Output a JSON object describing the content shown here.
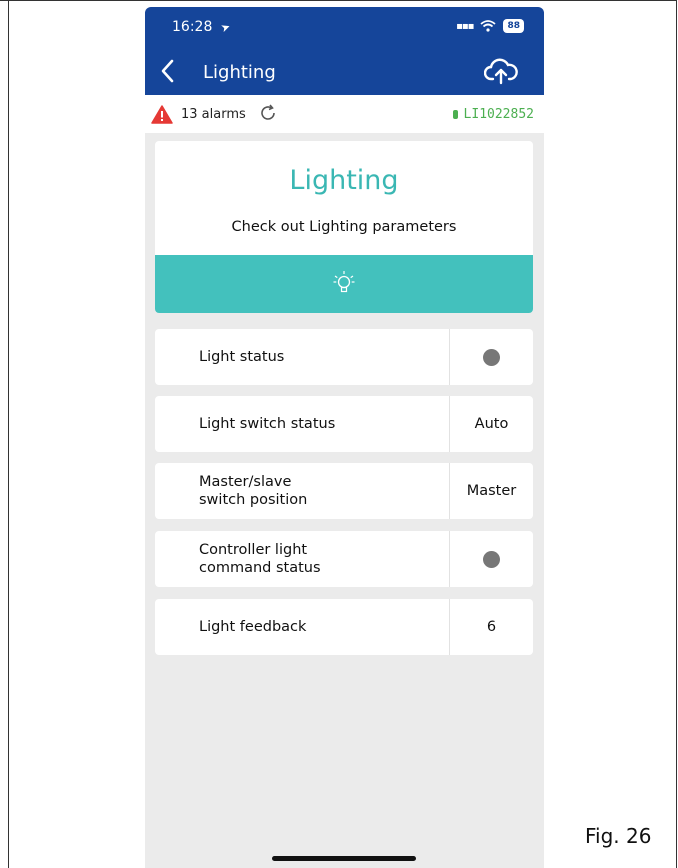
{
  "statusbar": {
    "time": "16:28",
    "battery": "88"
  },
  "navbar": {
    "title": "Lighting"
  },
  "alarmbar": {
    "alarms": "13 alarms",
    "device_id": "LI1022852"
  },
  "card": {
    "title": "Lighting",
    "subtitle": "Check out Lighting parameters"
  },
  "rows": [
    {
      "label": "Light status",
      "value": ""
    },
    {
      "label": "Light switch status",
      "value": "Auto"
    },
    {
      "label": "Master/slave switch position",
      "value": "Master"
    },
    {
      "label": "Controller light command status",
      "value": ""
    },
    {
      "label": "Light feedback",
      "value": "6"
    }
  ],
  "figure_caption": "Fig. 26",
  "colors": {
    "header": "#15459a",
    "accent": "#43c1bd",
    "title": "#3ab7b3",
    "device": "#4caf50",
    "alarm": "#e53935",
    "indicator_dot": "#777777"
  },
  "icons": [
    "location-arrow-icon",
    "signal-icon",
    "wifi-icon",
    "battery-icon",
    "back-chevron-icon",
    "cloud-upload-icon",
    "alarm-warning-icon",
    "refresh-icon",
    "lightbulb-icon",
    "status-dot-icon"
  ]
}
